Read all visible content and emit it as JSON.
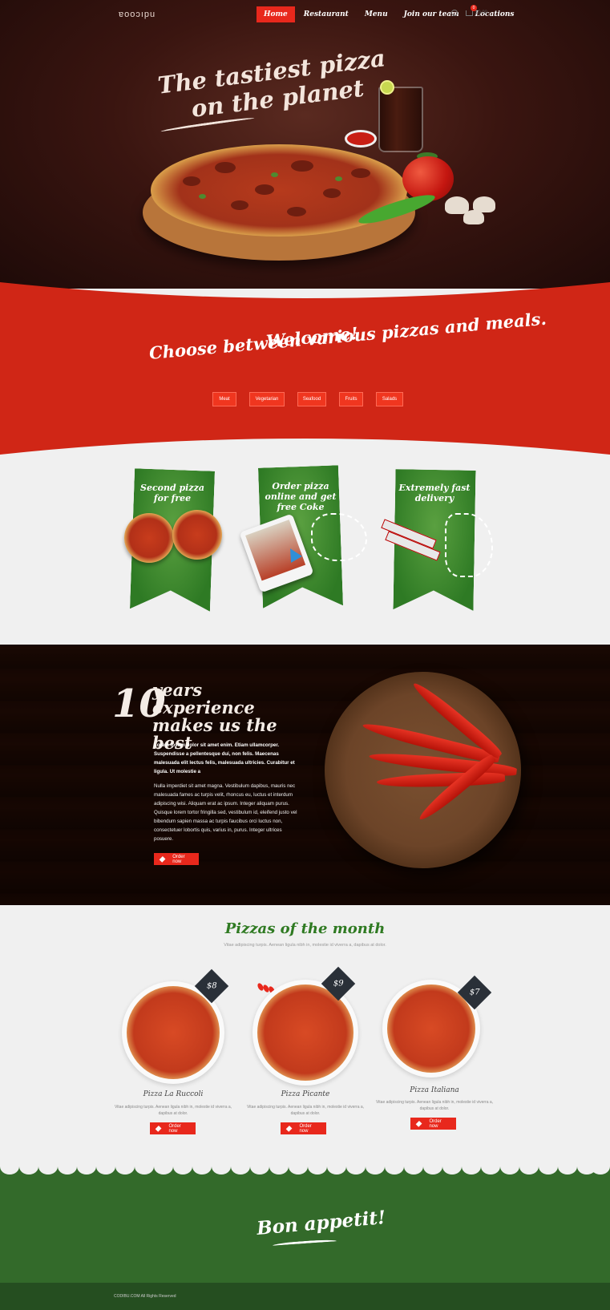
{
  "header": {
    "logo": "ɐooɔıpu",
    "nav": [
      "Home",
      "Restaurant",
      "Menu",
      "Join our team",
      "Locations"
    ],
    "cart_badge": "0",
    "cart_value": "$0.00"
  },
  "hero": {
    "title_line1": "The tastiest pizza",
    "title_line2": "on the planet"
  },
  "welcome": {
    "line1": "Welcome!",
    "line2": "Choose between various pizzas and meals.",
    "categories": [
      "Meat",
      "Vegetarian",
      "Seafood",
      "Fruits",
      "Salads"
    ]
  },
  "features": [
    {
      "title": "Second pizza for free"
    },
    {
      "title": "Order pizza online and get free Coke"
    },
    {
      "title": "Extremely fast delivery"
    }
  ],
  "experience": {
    "number": "10",
    "title": "years experience makes us the best",
    "lead": "Lorem ipsum dolor sit amet enim. Etiam ullamcorper. Suspendisse a pellentesque dui, non felis. Maecenas malesuada elit lectus felis, malesuada ultricies. Curabitur et ligula. Ut molestie a",
    "body": "Nulla imperdiet sit amet magna. Vestibulum dapibus, mauris nec malesuada fames ac turpis velit, rhoncus eu, luctus et interdum adipiscing wisi. Aliquam erat ac ipsum. Integer aliquam purus. Quisque lorem tortor fringilla sed, vestibulum id, eleifend justo vel bibendum sapien massa ac turpis faucibus orci luctus non, consectetuer lobortis quis, varius in, purus. Integer ultrices posuere.",
    "button": "Order now"
  },
  "pizzas_of_month": {
    "title": "Pizzas of the month",
    "subtitle": "Vitae adipiscing turpis. Aenean ligula nibh in, molestie id viverra a, dapibus at dolor.",
    "items": [
      {
        "name": "Pizza La Ruccoli",
        "price": "$8",
        "desc": "Vitae adipiscing turpis. Aenean ligula nibh in, molestie id viverra a, dapibus at dolor.",
        "button": "Order now"
      },
      {
        "name": "Pizza Picante",
        "price": "$9",
        "desc": "Vitae adipiscing turpis. Aenean ligula nibh in, molestie id viverra a, dapibus at dolor.",
        "button": "Order now"
      },
      {
        "name": "Pizza Italiana",
        "price": "$7",
        "desc": "Vitae adipiscing turpis. Aenean ligula nibh in, molestie id viverra a, dapibus at dolor.",
        "button": "Order now"
      }
    ]
  },
  "bon_appetit": "Bon appetit!",
  "footer": "CODIBU.COM All Rights Reserved",
  "colors": {
    "accent": "#e8281c",
    "green": "#336a2a",
    "dark": "#1e0a08"
  }
}
